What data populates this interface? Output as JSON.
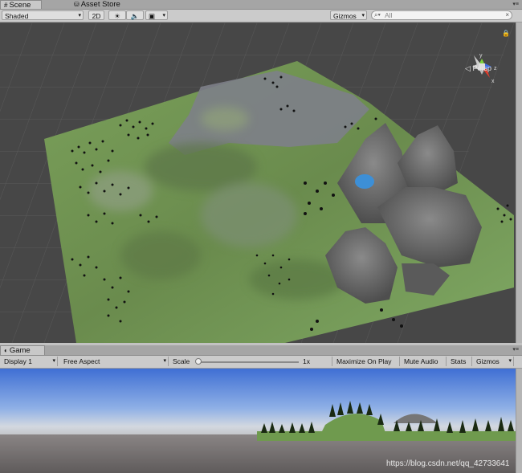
{
  "scene_tabs": {
    "scene": "Scene",
    "asset_store": "Asset Store"
  },
  "scene_toolbar": {
    "shading": "Shaded",
    "mode_2d": "2D",
    "gizmos": "Gizmos",
    "search_placeholder": "All"
  },
  "scene_view": {
    "projection": "Persp",
    "gizmo_axes": {
      "y": "y",
      "z": "z",
      "x": "x"
    }
  },
  "game_tab": {
    "label": "Game"
  },
  "game_toolbar": {
    "display": "Display 1",
    "aspect": "Free Aspect",
    "scale_label": "Scale",
    "scale_value": "1x",
    "scale_fraction": 0.0,
    "maximize_on_play": "Maximize On Play",
    "mute_audio": "Mute Audio",
    "stats": "Stats",
    "gizmos": "Gizmos"
  },
  "watermark": "https://blog.csdn.net/qq_42733641",
  "icons": [
    "scene-grid-icon",
    "asset-store-bag-icon",
    "sun-light-icon",
    "speaker-icon",
    "image-effects-icon",
    "search-icon",
    "lock-icon",
    "game-controller-icon",
    "panel-menu-icon"
  ],
  "colors": {
    "editor_bg": "#c2c2c2",
    "terrain_green": "#6f9150",
    "sky_top": "#4b7ad9",
    "ground": "#676464"
  }
}
